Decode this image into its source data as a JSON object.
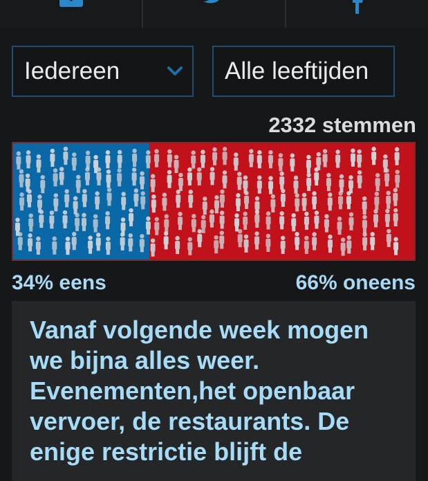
{
  "share": {
    "buttons": [
      {
        "icon": "mail-icon"
      },
      {
        "icon": "twitter-icon"
      },
      {
        "icon": "facebook-icon"
      }
    ]
  },
  "filters": {
    "group": {
      "value": "Iedereen",
      "icon": "chevron-down-icon"
    },
    "age": {
      "value": "Alle leeftijden"
    }
  },
  "poll": {
    "votes_label": "2332 stemmen",
    "agree_fraction": 0.34,
    "disagree_fraction": 0.66,
    "agree_label": "34% eens",
    "disagree_label": "66% oneens"
  },
  "colors": {
    "agree": "#0a68a6",
    "disagree": "#c1121b",
    "accent_text": "#a6dcf7"
  },
  "statement": {
    "text": "Vanaf volgende week mogen we bijna alles weer. Evenementen,het openbaar vervoer, de restaurants. De enige restrictie blijft de"
  }
}
